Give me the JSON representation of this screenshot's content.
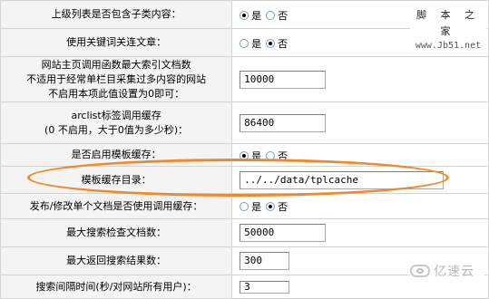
{
  "rows": [
    {
      "label": "上级列表是否包含子类内容：",
      "type": "radio",
      "options": [
        {
          "label": "是",
          "checked": true
        },
        {
          "label": "否",
          "checked": false
        }
      ]
    },
    {
      "label": "使用关键词关连文章：",
      "type": "radio",
      "options": [
        {
          "label": "是",
          "checked": false
        },
        {
          "label": "否",
          "checked": true
        }
      ]
    },
    {
      "label": "网站主页调用函数最大索引文档数\n不适用于经常单栏目采集过多内容的网站\n不启用本项此值设置为0即可：",
      "type": "text",
      "value": "10000"
    },
    {
      "label": "arclist标签调用缓存\n(0 不启用，大于0值为多少秒)：",
      "type": "text",
      "value": "86400"
    },
    {
      "label": "是否启用模板缓存：",
      "type": "radio",
      "options": [
        {
          "label": "是",
          "checked": true
        },
        {
          "label": "否",
          "checked": false
        }
      ]
    },
    {
      "label": "模板缓存目录：",
      "type": "text",
      "value": "../../data/tplcache"
    },
    {
      "label": "发布/修改单个文档是否使用调用缓存：",
      "type": "radio",
      "options": [
        {
          "label": "是",
          "checked": false
        },
        {
          "label": "否",
          "checked": true
        }
      ]
    },
    {
      "label": "最大搜索检查文档数：",
      "type": "text",
      "value": "50000"
    },
    {
      "label": "最大返回搜索结果数：",
      "type": "text",
      "value": "300"
    },
    {
      "label": "搜索间隔时间(秒/对网站所有用户)：",
      "type": "text",
      "value": "3"
    }
  ],
  "watermark_top": {
    "name": "脚 本 之 家",
    "url": "www.Jb51.net"
  },
  "watermark_bottom": {
    "text": "亿速云"
  },
  "colors": {
    "highlight": "#ee8a2c",
    "label_bg": "#f4f4f4",
    "border": "#d4d4d4"
  }
}
